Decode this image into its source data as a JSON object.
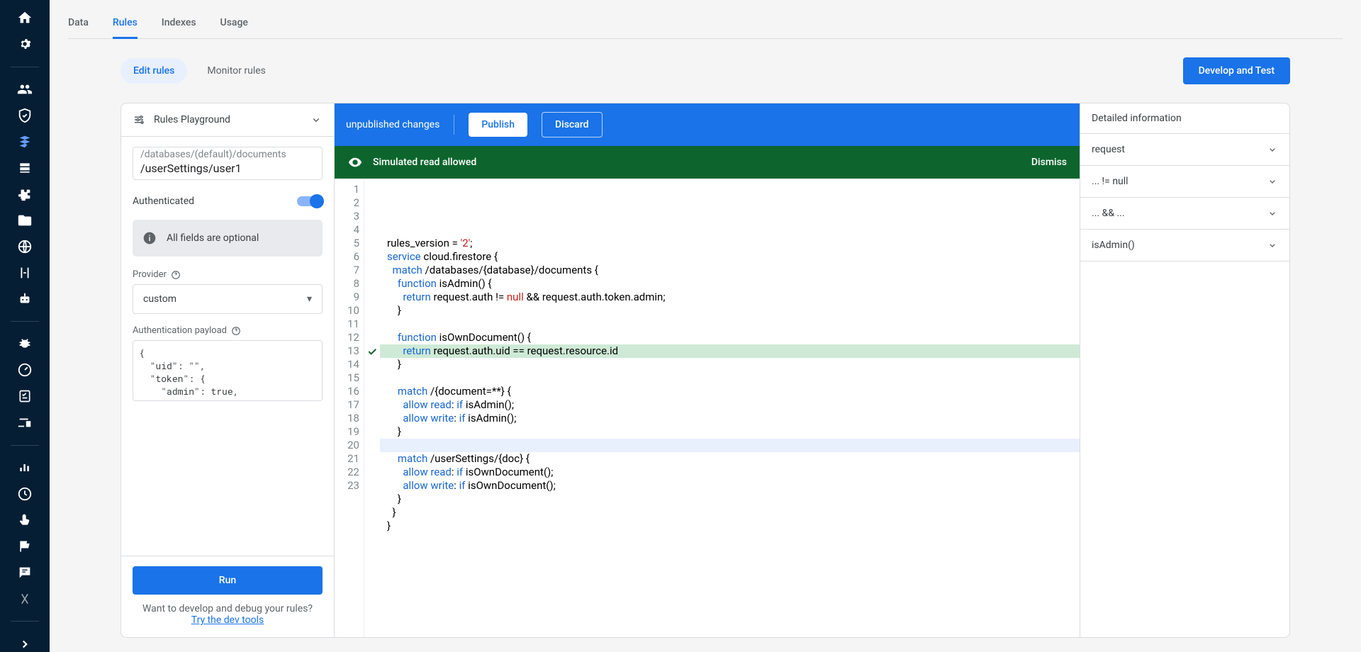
{
  "tabs": {
    "data": "Data",
    "rules": "Rules",
    "indexes": "Indexes",
    "usage": "Usage"
  },
  "subtabs": {
    "edit": "Edit rules",
    "monitor": "Monitor rules"
  },
  "develop_btn": "Develop and Test",
  "playground": {
    "title": "Rules Playground",
    "path_placeholder": "/databases/(default)/documents",
    "path_value": "/userSettings/user1",
    "auth_label": "Authenticated",
    "info": "All fields are optional",
    "provider_label": "Provider",
    "provider_value": "custom",
    "payload_label": "Authentication payload",
    "payload_value": "{\n  \"uid\": \"\",\n  \"token\": {\n    \"admin\": true,",
    "run": "Run",
    "hint_text": "Want to develop and debug your rules?",
    "hint_link": "Try the dev tools"
  },
  "topbar": {
    "status": "unpublished changes",
    "publish": "Publish",
    "discard": "Discard"
  },
  "simbar": {
    "msg": "Simulated read allowed",
    "dismiss": "Dismiss"
  },
  "code_lines": [
    "rules_version = '2';",
    "service cloud.firestore {",
    "  match /databases/{database}/documents {",
    "    function isAdmin() {",
    "      return request.auth != null && request.auth.token.admin;",
    "    }",
    "",
    "    function isOwnDocument() {",
    "      return request.auth.uid == request.resource.id",
    "    }",
    "",
    "    match /{document=**} {",
    "      allow read: if isAdmin();",
    "      allow write: if isAdmin();",
    "    }",
    "",
    "    match /userSettings/{doc} {",
    "      allow read: if isOwnDocument();",
    "      allow write: if isOwnDocument();",
    "    }",
    "  }",
    "}",
    ""
  ],
  "details": {
    "title": "Detailed information",
    "rows": [
      "request",
      "... != null",
      "... && ...",
      "isAdmin()"
    ]
  }
}
